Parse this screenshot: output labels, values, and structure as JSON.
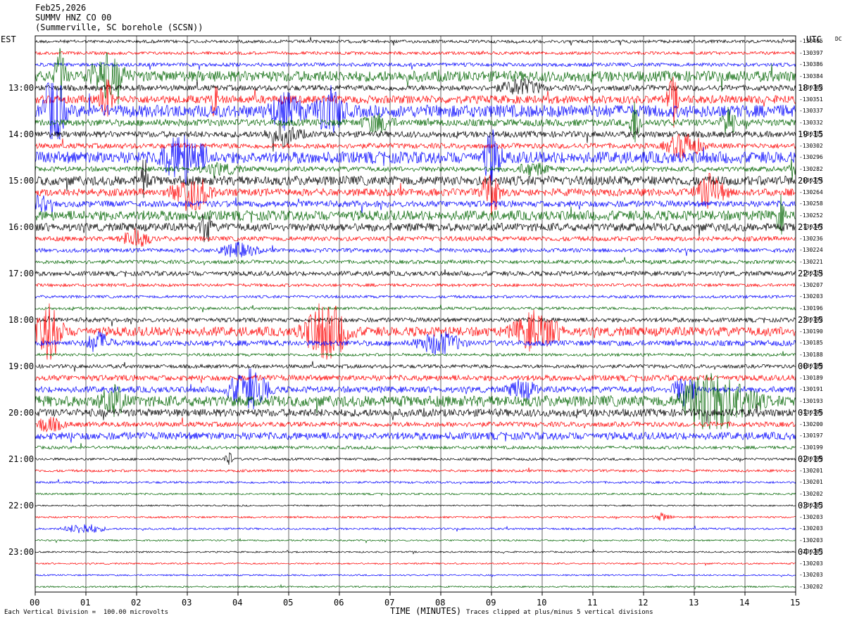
{
  "header": {
    "date": "Feb25,2026",
    "station": "SUMMV HNZ CO 00",
    "location": "(Summerville, SC borehole (SCSN))"
  },
  "chart_data": {
    "type": "seismogram (helicorder)",
    "left_axis_label": "EST",
    "right_axis_label": "UTC",
    "dc_label": "DC",
    "xlabel": "TIME (MINUTES)",
    "x_ticks": [
      "00",
      "01",
      "02",
      "03",
      "04",
      "05",
      "06",
      "07",
      "08",
      "09",
      "10",
      "11",
      "12",
      "13",
      "14",
      "15"
    ],
    "xlim": [
      0,
      15
    ],
    "trace_colors": [
      "#000000",
      "#ff0000",
      "#0000ff",
      "#006400"
    ],
    "minutes_per_line": 15,
    "est_labels": [
      "13:00",
      "14:00",
      "15:00",
      "16:00",
      "17:00",
      "18:00",
      "19:00",
      "20:00",
      "21:00",
      "22:00",
      "23:00"
    ],
    "utc_labels": [
      "18:15",
      "19:15",
      "20:15",
      "21:15",
      "22:15",
      "23:15",
      "00:15",
      "01:15",
      "02:15",
      "03:15",
      "04:15"
    ],
    "dc_offsets": [
      "-130405",
      "-130397",
      "-130386",
      "-130384",
      "-130362",
      "-130351",
      "-130337",
      "-130332",
      "-130315",
      "-130302",
      "-130296",
      "-130282",
      "-130274",
      "-130264",
      "-130258",
      "-130252",
      "-130247",
      "-130236",
      "-130224",
      "-130221",
      "-130214",
      "-130207",
      "-130203",
      "-130196",
      "-130192",
      "-130190",
      "-130185",
      "-130188",
      "-130189",
      "-130189",
      "-130191",
      "-130193",
      "-130196",
      "-130200",
      "-130197",
      "-130199",
      "-130199",
      "-130201",
      "-130201",
      "-130202",
      "-130203",
      "-130203",
      "-130203",
      "-130203",
      "-130203",
      "-130203",
      "-130203",
      "-130202"
    ],
    "trace_noise_level": [
      1.0,
      1.0,
      1.2,
      3.5,
      1.8,
      2.6,
      4.0,
      2.2,
      2.0,
      1.7,
      3.8,
      1.6,
      3.0,
      2.4,
      2.0,
      3.2,
      2.6,
      1.5,
      1.3,
      1.2,
      1.5,
      1.0,
      0.9,
      0.9,
      1.4,
      3.0,
      1.8,
      0.9,
      1.2,
      1.8,
      2.0,
      3.5,
      2.5,
      1.6,
      2.4,
      1.0,
      0.8,
      0.8,
      0.7,
      0.6,
      0.5,
      0.6,
      0.6,
      0.5,
      0.5,
      0.5,
      0.5,
      0.5
    ]
  },
  "footer": {
    "scale_note": "Each Vertical Division =  100.00 microvolts",
    "clip_note": "Traces clipped at plus/minus 5 vertical divisions"
  }
}
